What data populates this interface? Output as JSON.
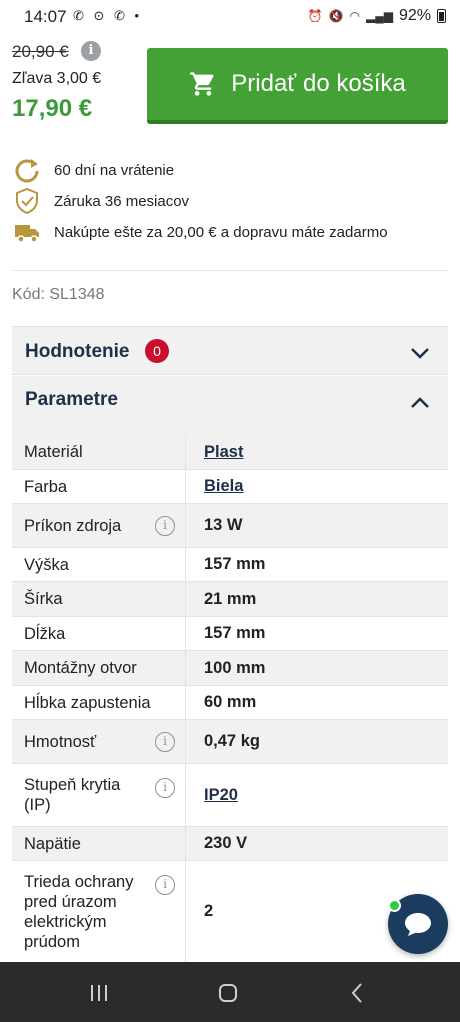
{
  "status_bar": {
    "time": "14:07",
    "left_icons": "✆ ⊙ ✆ •",
    "battery": "92%"
  },
  "pricing": {
    "old_price": "20,90 €",
    "discount": "Zľava 3,00 €",
    "new_price": "17,90 €",
    "info_glyph": "i"
  },
  "cart_button": {
    "label": "Pridať do košíka"
  },
  "benefits": [
    {
      "icon": "return-arrow-icon",
      "text": "60 dní na vrátenie"
    },
    {
      "icon": "shield-check-icon",
      "text": "Záruka 36 mesiacov"
    },
    {
      "icon": "truck-icon",
      "text": "Nakúpte ešte za 20,00 € a dopravu máte zadarmo"
    }
  ],
  "product_code": "Kód: SL1348",
  "reviews": {
    "title": "Hodnotenie",
    "count": "0"
  },
  "parameters": {
    "title": "Parametre",
    "rows": [
      {
        "key": "Materiál",
        "value": "Plast",
        "link": true,
        "info": false
      },
      {
        "key": "Farba",
        "value": "Biela",
        "link": true,
        "info": false
      },
      {
        "key": "Príkon zdroja",
        "value": "13 W",
        "link": false,
        "info": true
      },
      {
        "key": "Výška",
        "value": "157 mm",
        "link": false,
        "info": false
      },
      {
        "key": "Šírka",
        "value": "21 mm",
        "link": false,
        "info": false
      },
      {
        "key": "Dĺžka",
        "value": "157 mm",
        "link": false,
        "info": false
      },
      {
        "key": "Montážny otvor",
        "value": "100 mm",
        "link": false,
        "info": false
      },
      {
        "key": "Hĺbka zapustenia",
        "value": "60 mm",
        "link": false,
        "info": false
      },
      {
        "key": "Hmotnosť",
        "value": "0,47 kg",
        "link": false,
        "info": true
      },
      {
        "key": "Stupeň krytia (IP)",
        "value": "IP20",
        "link": true,
        "info": true
      },
      {
        "key": "Napätie",
        "value": "230 V",
        "link": false,
        "info": false
      },
      {
        "key": "Trieda ochrany pred úrazom elektrickým prúdom",
        "value": "2",
        "link": false,
        "info": true
      }
    ]
  },
  "colors": {
    "accent_green": "#43a136",
    "price_green": "#3d9a3a",
    "navy": "#1e2f4a",
    "badge_red": "#c8102e",
    "benefit_gold": "#b8963e"
  }
}
